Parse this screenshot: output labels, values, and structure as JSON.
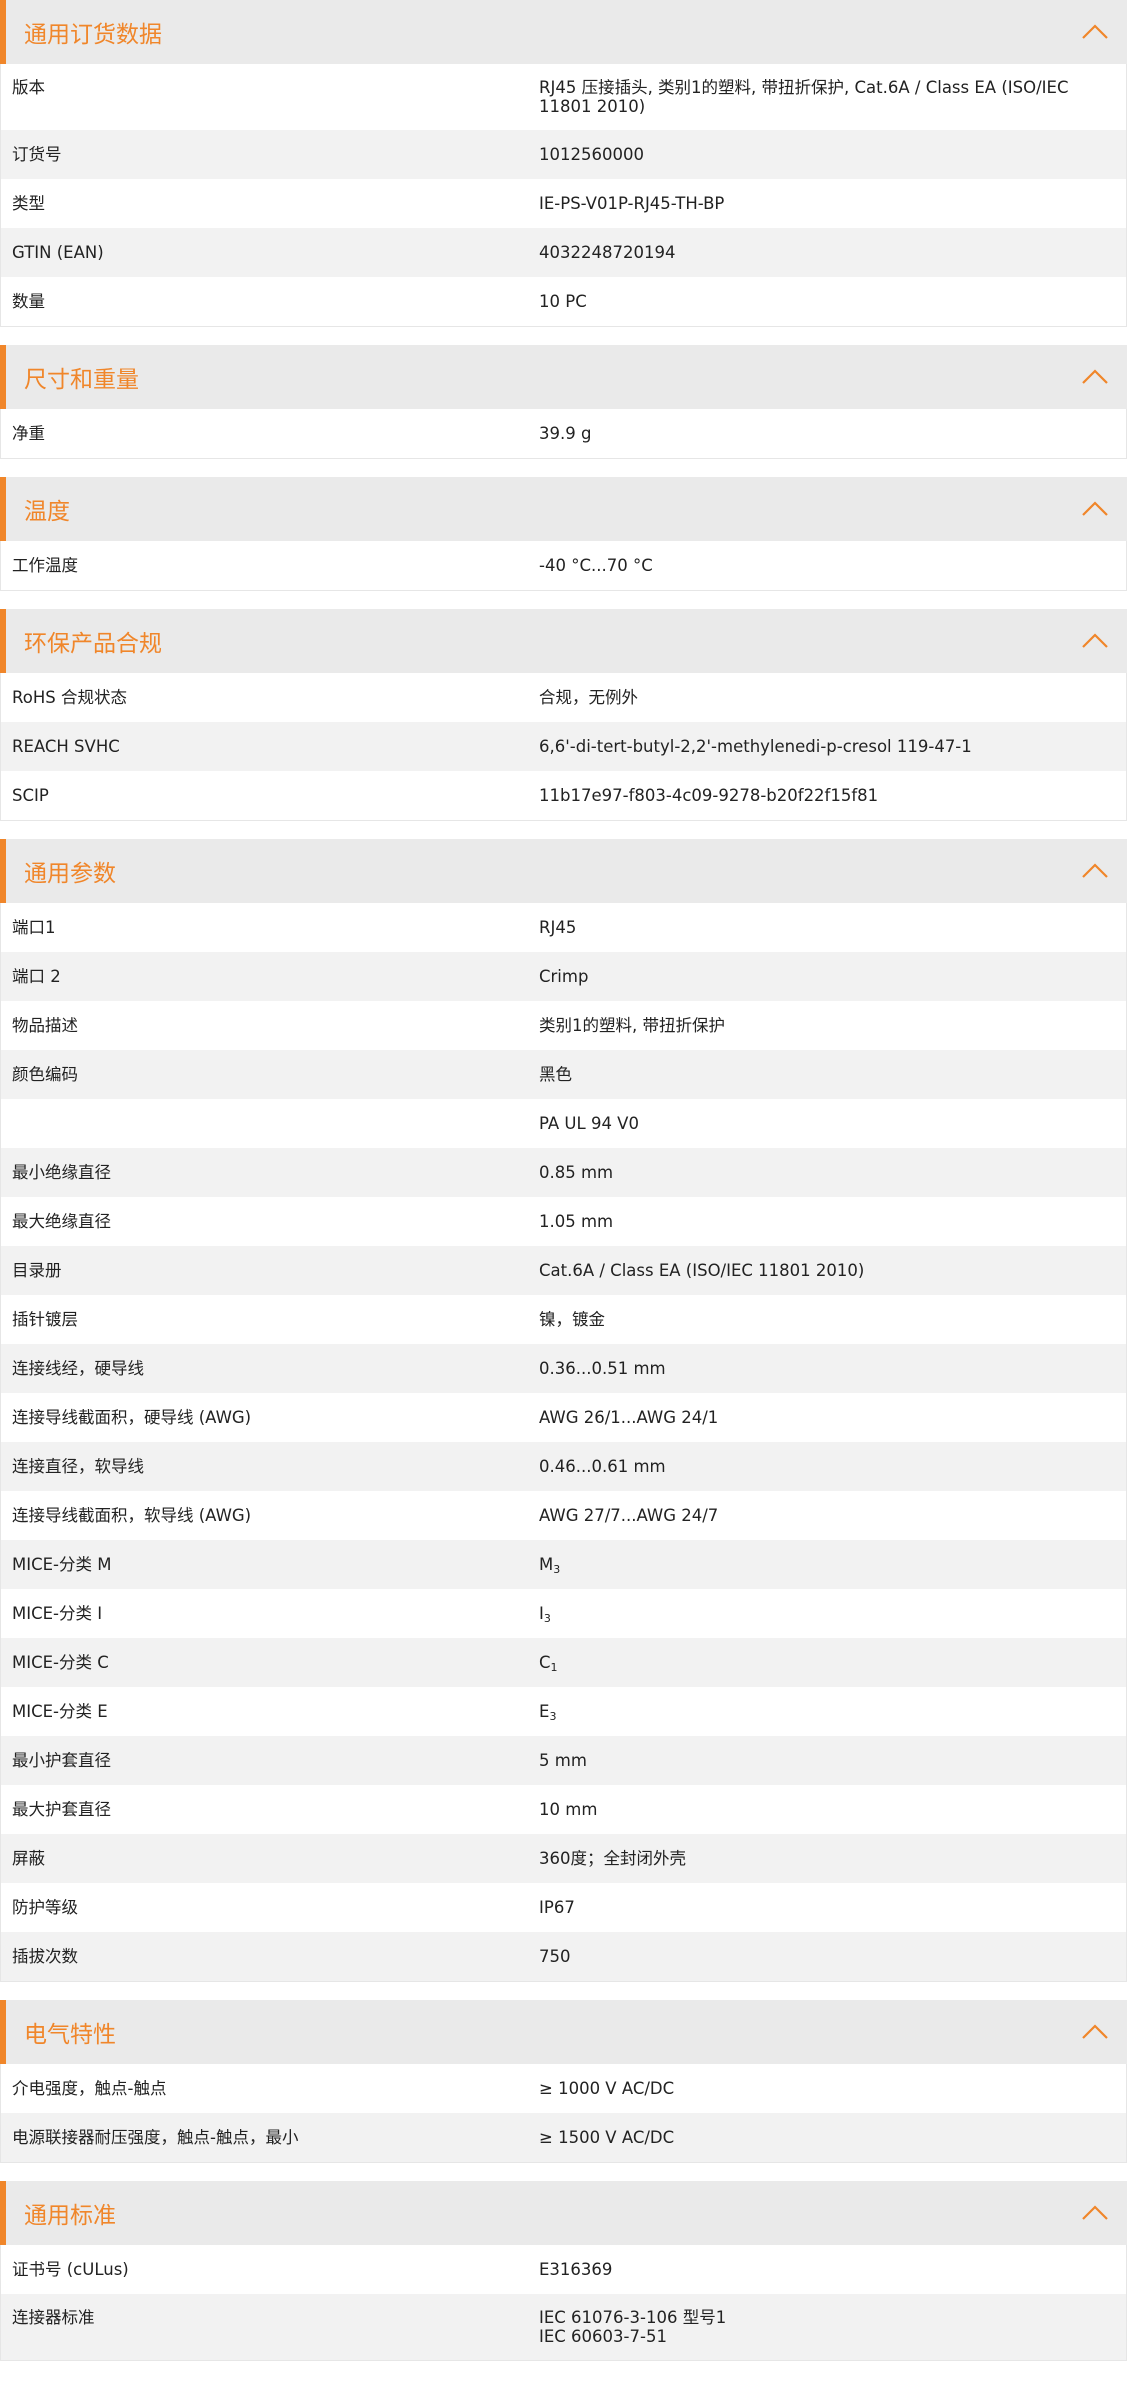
{
  "accent_color": "#f0862a",
  "sections": [
    {
      "title": "通用订货数据",
      "rows": [
        {
          "label": "版本",
          "value": "RJ45 压接插头, 类别1的塑料, 带扭折保护, Cat.6A / Class EA (ISO/IEC\n11801 2010)"
        },
        {
          "label": "订货号",
          "value": "1012560000"
        },
        {
          "label": "类型",
          "value": "IE-PS-V01P-RJ45-TH-BP"
        },
        {
          "label": "GTIN (EAN)",
          "value": "4032248720194"
        },
        {
          "label": "数量",
          "value": "10  PC"
        }
      ]
    },
    {
      "title": "尺寸和重量",
      "rows": [
        {
          "label": "净重",
          "value": "39.9  g"
        }
      ]
    },
    {
      "title": "温度",
      "rows": [
        {
          "label": "工作温度",
          "value": "-40 °C...70 °C"
        }
      ]
    },
    {
      "title": "环保产品合规",
      "rows": [
        {
          "label": "RoHS 合规状态",
          "value": "合规，无例外"
        },
        {
          "label": "REACH SVHC",
          "value": "6,6'-di-tert-butyl-2,2'-methylenedi-p-cresol 119-47-1"
        },
        {
          "label": "SCIP",
          "value": "11b17e97-f803-4c09-9278-b20f22f15f81"
        }
      ]
    },
    {
      "title": "通用参数",
      "rows": [
        {
          "label": "端口1",
          "value": "RJ45"
        },
        {
          "label": "端口 2",
          "value": "Crimp"
        },
        {
          "label": "物品描述",
          "value": "类别1的塑料, 带扭折保护"
        },
        {
          "label": "颜色编码",
          "value": "黑色"
        },
        {
          "label": "",
          "value": "PA UL 94 V0"
        },
        {
          "label": "最小绝缘直径",
          "value": "0.85  mm"
        },
        {
          "label": "最大绝缘直径",
          "value": "1.05  mm"
        },
        {
          "label": "目录册",
          "value": "Cat.6A / Class EA (ISO/IEC 11801 2010)"
        },
        {
          "label": "插针镀层",
          "value": "镍，镀金"
        },
        {
          "label": "连接线经，硬导线",
          "value": "0.36...0.51 mm"
        },
        {
          "label": "连接导线截面积，硬导线 (AWG)",
          "value": "AWG 26/1...AWG 24/1"
        },
        {
          "label": "连接直径，软导线",
          "value": "0.46...0.61 mm"
        },
        {
          "label": "连接导线截面积，软导线 (AWG)",
          "value": "AWG 27/7...AWG 24/7"
        },
        {
          "label": "MICE-分类 M",
          "value": "M",
          "sub": "3"
        },
        {
          "label": "MICE-分类 I",
          "value": "I",
          "sub": "3"
        },
        {
          "label": "MICE-分类 C",
          "value": "C",
          "sub": "1"
        },
        {
          "label": "MICE-分类 E",
          "value": "E",
          "sub": "3"
        },
        {
          "label": "最小护套直径",
          "value": "5  mm"
        },
        {
          "label": "最大护套直径",
          "value": "10  mm"
        },
        {
          "label": "屏蔽",
          "value": "360度；全封闭外壳"
        },
        {
          "label": "防护等级",
          "value": "IP67"
        },
        {
          "label": "插拔次数",
          "value": "750"
        }
      ]
    },
    {
      "title": "电气特性",
      "rows": [
        {
          "label": "介电强度，触点-触点",
          "value": "≥ 1000 V AC/DC"
        },
        {
          "label": "电源联接器耐压强度，触点-触点，最小",
          "value": "≥ 1500 V AC/DC"
        }
      ]
    },
    {
      "title": "通用标准",
      "rows": [
        {
          "label": "证书号 (cULus)",
          "value": "E316369"
        },
        {
          "label": "连接器标准",
          "value": "IEC 61076-3-106 型号1\nIEC 60603-7-51"
        }
      ]
    }
  ]
}
